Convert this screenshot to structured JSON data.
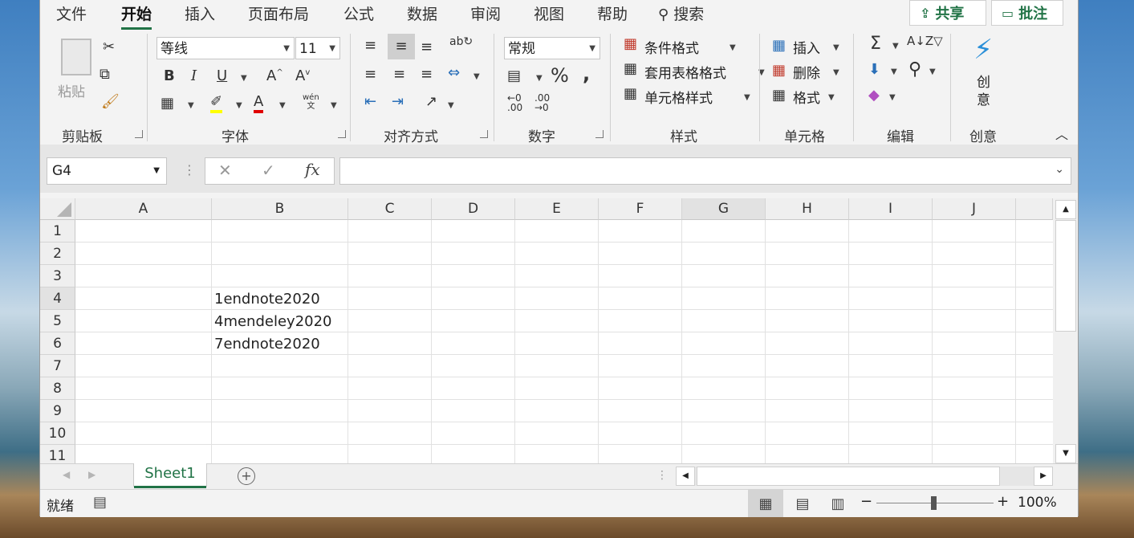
{
  "menu_tabs": [
    "文件",
    "开始",
    "插入",
    "页面布局",
    "公式",
    "数据",
    "审阅",
    "视图",
    "帮助"
  ],
  "search_label": "搜索",
  "share_label": "共享",
  "comment_label": "批注",
  "ribbon": {
    "clipboard": {
      "paste": "粘贴",
      "label": "剪贴板"
    },
    "font": {
      "name": "等线",
      "size": "11",
      "label": "字体",
      "phonetic_top": "wén",
      "phonetic_bottom": "文"
    },
    "alignment": {
      "label": "对齐方式"
    },
    "number": {
      "format": "常规",
      "label": "数字"
    },
    "styles": {
      "cond": "条件格式",
      "table": "套用表格格式",
      "cell": "单元格样式",
      "label": "样式"
    },
    "cells": {
      "insert": "插入",
      "delete": "删除",
      "format": "格式",
      "label": "单元格"
    },
    "editing": {
      "label": "编辑"
    },
    "ideas": {
      "button_top": "创",
      "button_bottom": "意",
      "label": "创意"
    }
  },
  "formula_bar": {
    "name_box": "G4",
    "fx": "fx",
    "content": ""
  },
  "columns": [
    "A",
    "B",
    "C",
    "D",
    "E",
    "F",
    "G",
    "H",
    "I",
    "J"
  ],
  "rows": [
    "1",
    "2",
    "3",
    "4",
    "5",
    "6",
    "7",
    "8",
    "9",
    "10",
    "11"
  ],
  "cells": {
    "B4": "1endnote2020",
    "B5": "4mendeley2020",
    "B6": "7endnote2020"
  },
  "sheet_tab": "Sheet1",
  "status": {
    "ready": "就绪",
    "zoom": "100%"
  }
}
